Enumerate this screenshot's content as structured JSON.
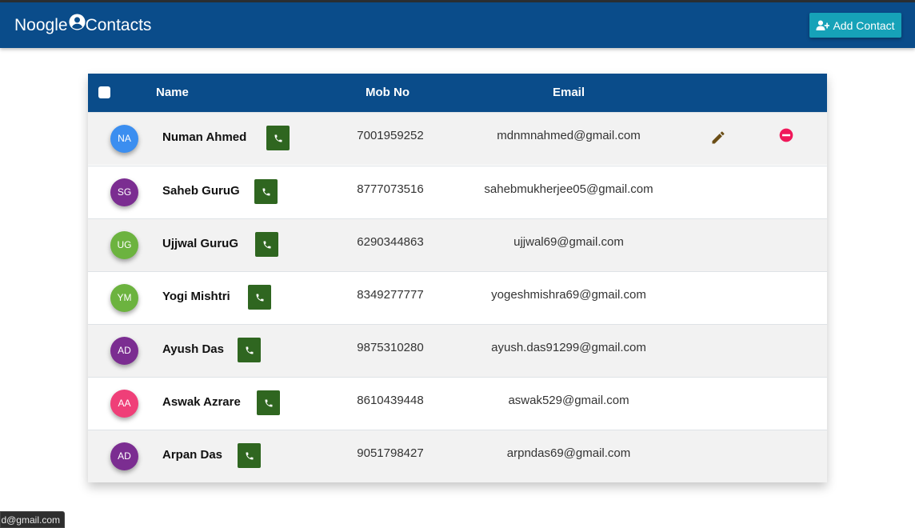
{
  "navbar": {
    "brand_prefix": "Noogle",
    "brand_suffix": "Contacts",
    "add_label": "Add Contact"
  },
  "table": {
    "headers": {
      "name": "Name",
      "mob": "Mob No",
      "email": "Email"
    },
    "rows": [
      {
        "initials": "NA",
        "avatar_color": "#3b8ef0",
        "name": "Numan Ahmed",
        "mobile": "7001959252",
        "email": "mdnmnahmed@gmail.com",
        "actions_visible": true
      },
      {
        "initials": "SG",
        "avatar_color": "#7b2d91",
        "name": "Saheb GuruG",
        "mobile": "8777073516",
        "email": "sahebmukherjee05@gmail.com",
        "actions_visible": false
      },
      {
        "initials": "UG",
        "avatar_color": "#6cb33f",
        "name": "Ujjwal GuruG",
        "mobile": "6290344863",
        "email": "ujjwal69@gmail.com",
        "actions_visible": false
      },
      {
        "initials": "YM",
        "avatar_color": "#6cb33f",
        "name": "Yogi Mishtri",
        "mobile": "8349277777",
        "email": "yogeshmishra69@gmail.com",
        "actions_visible": false
      },
      {
        "initials": "AD",
        "avatar_color": "#7b2d91",
        "name": "Ayush Das",
        "mobile": "9875310280",
        "email": "ayush.das91299@gmail.com",
        "actions_visible": false
      },
      {
        "initials": "AA",
        "avatar_color": "#ef3f78",
        "name": "Aswak Azrare",
        "mobile": "8610439448",
        "email": "aswak529@gmail.com",
        "actions_visible": false
      },
      {
        "initials": "AD",
        "avatar_color": "#7b2d91",
        "name": "Arpan Das",
        "mobile": "9051798427",
        "email": "arpndas69@gmail.com",
        "actions_visible": false
      }
    ]
  },
  "status_bar": {
    "text": "d@gmail.com"
  },
  "colors": {
    "navbar": "#0a4c8a",
    "add_button": "#16a2b8",
    "phone_button": "#2f6620",
    "edit_icon": "#6b4e16",
    "delete_icon": "#f0185a"
  },
  "icons": {
    "brand": "user-circle-icon",
    "add": "user-plus-icon",
    "phone": "phone-icon",
    "edit": "pencil-icon",
    "delete": "minus-circle-icon"
  }
}
